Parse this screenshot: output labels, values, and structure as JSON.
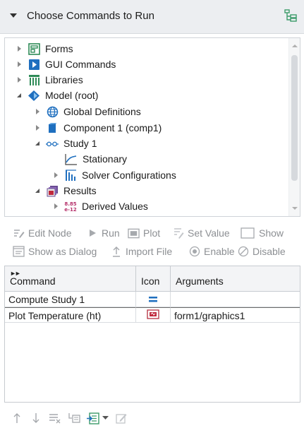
{
  "header": {
    "title": "Choose Commands to Run",
    "tree_icon": "command-tree-icon"
  },
  "tree": {
    "items": [
      {
        "label": "Forms",
        "icon": "forms-icon",
        "state": "closed"
      },
      {
        "label": "GUI Commands",
        "icon": "gui-commands-icon",
        "state": "closed"
      },
      {
        "label": "Libraries",
        "icon": "libraries-icon",
        "state": "closed"
      },
      {
        "label": "Model (root)",
        "icon": "model-root-icon",
        "state": "open"
      },
      {
        "label": "Global Definitions",
        "icon": "globe-icon",
        "state": "closed"
      },
      {
        "label": "Component 1 (comp1)",
        "icon": "component-icon",
        "state": "closed"
      },
      {
        "label": "Study 1",
        "icon": "study-icon",
        "state": "open"
      },
      {
        "label": "Stationary",
        "icon": "stationary-icon",
        "state": "leaf"
      },
      {
        "label": "Solver Configurations",
        "icon": "solver-configurations-icon",
        "state": "closed"
      },
      {
        "label": "Results",
        "icon": "results-icon",
        "state": "open"
      },
      {
        "label": "Derived Values",
        "icon": "derived-values-icon",
        "state": "closed",
        "icon_text": [
          "8.85",
          "e-12"
        ]
      }
    ]
  },
  "actions": {
    "edit_node": "Edit Node",
    "run": "Run",
    "plot": "Plot",
    "set_value": "Set Value",
    "show": "Show",
    "show_as_dialog": "Show as Dialog",
    "import_file": "Import File",
    "enable": "Enable",
    "disable": "Disable"
  },
  "table": {
    "columns": [
      "Command",
      "Icon",
      "Arguments"
    ],
    "rows": [
      {
        "command": "Compute Study 1",
        "icon": "compute-icon",
        "arguments": ""
      },
      {
        "command": "Plot Temperature (ht)",
        "icon": "plot-icon",
        "arguments": "form1/graphics1"
      }
    ]
  },
  "bottom_toolbar": [
    "move-up-icon",
    "move-down-icon",
    "delete-icon",
    "clear-table-icon",
    "add-to-table-icon",
    "dropdown-arrow-icon",
    "edit-arguments-icon"
  ],
  "colors": {
    "accent_blue": "#1f6fbf",
    "header_bg": "#eceef1",
    "green_icon": "#3c9b6a",
    "red_icon": "#c0283c"
  }
}
